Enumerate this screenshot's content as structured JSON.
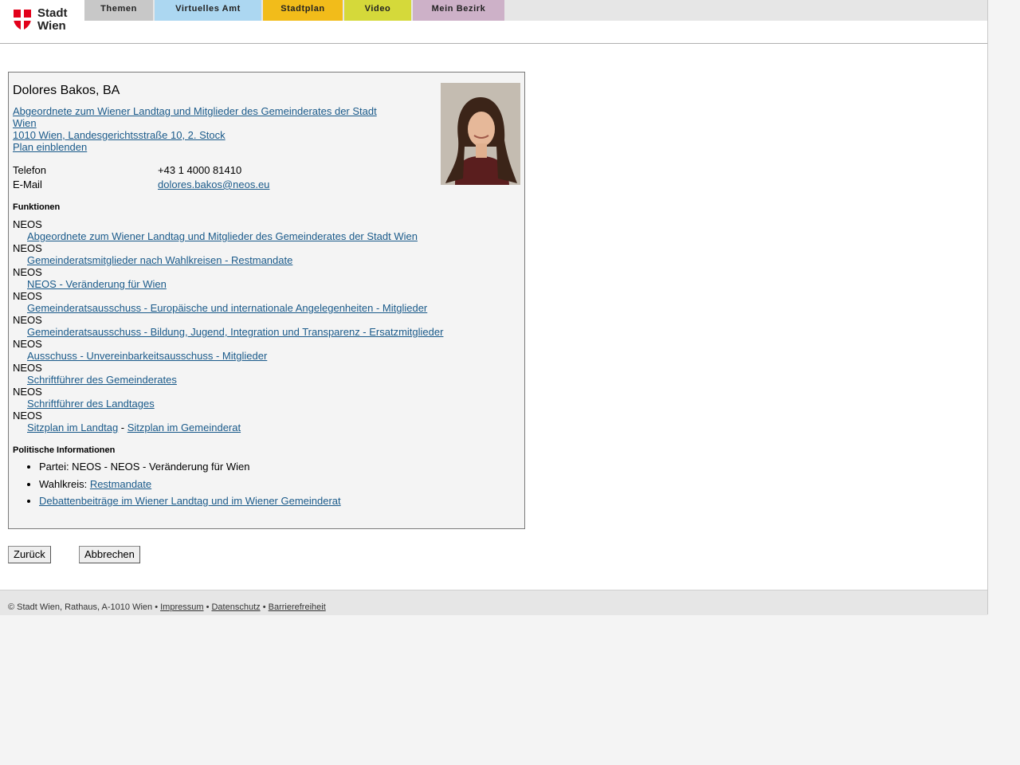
{
  "logo": {
    "line1": "Stadt",
    "line2": "Wien"
  },
  "nav": {
    "tabs": [
      "Themen",
      "Virtuelles Amt",
      "Stadtplan",
      "Video",
      "Mein Bezirk"
    ]
  },
  "colors": {
    "tab_themen": "#c8c8c8",
    "tab_virtuelles_amt": "#acd7f1",
    "tab_stadtplan": "#f2bc1a",
    "tab_video": "#d5d93a",
    "tab_mein_bezirk": "#cdb1c8",
    "link": "#1a5a8a",
    "logo_red": "#e2001a"
  },
  "person": {
    "name": "Dolores Bakos, BA",
    "role_link": "Abgeordnete zum Wiener Landtag und Mitglieder des Gemeinderates der Stadt Wien",
    "address_link": "1010 Wien, Landesgerichtsstraße 10, 2. Stock",
    "map_link": "Plan einblenden"
  },
  "contact": {
    "phone_label": "Telefon",
    "phone_value": "+43 1 4000 81410",
    "email_label": "E-Mail",
    "email_value": "dolores.bakos@neos.eu"
  },
  "functions": {
    "title": "Funktionen",
    "items": [
      {
        "party": "NEOS",
        "link": "Abgeordnete zum Wiener Landtag und Mitglieder des Gemeinderates der Stadt Wien"
      },
      {
        "party": "NEOS",
        "link": "Gemeinderatsmitglieder nach Wahlkreisen - Restmandate"
      },
      {
        "party": "NEOS",
        "link": "NEOS - Veränderung für Wien"
      },
      {
        "party": "NEOS",
        "link": "Gemeinderatsausschuss - Europäische und internationale Angelegenheiten - Mitglieder"
      },
      {
        "party": "NEOS",
        "link": "Gemeinderatsausschuss - Bildung, Jugend, Integration und Transparenz - Ersatzmitglieder"
      },
      {
        "party": "NEOS",
        "link": "Ausschuss - Unvereinbarkeitsausschuss - Mitglieder"
      },
      {
        "party": "NEOS",
        "link": "Schriftführer des Gemeinderates"
      },
      {
        "party": "NEOS",
        "link": "Schriftführer des Landtages"
      }
    ],
    "last_party": "NEOS",
    "seat_landtag": "Sitzplan im Landtag",
    "seat_separator": " - ",
    "seat_gemeinderat": "Sitzplan im Gemeinderat"
  },
  "political": {
    "title": "Politische Informationen",
    "party_text": "Partei: NEOS - NEOS - Veränderung für Wien",
    "wahlkreis_label": "Wahlkreis: ",
    "wahlkreis_link": "Restmandate",
    "debate_link": "Debattenbeiträge im Wiener Landtag und im Wiener Gemeinderat"
  },
  "buttons": {
    "back": "Zurück",
    "cancel": "Abbrechen"
  },
  "footer": {
    "copyright": "© Stadt Wien, Rathaus, A-1010 Wien",
    "sep": " • ",
    "impressum": "Impressum",
    "datenschutz": "Datenschutz",
    "barrierefreiheit": "Barrierefreiheit"
  }
}
